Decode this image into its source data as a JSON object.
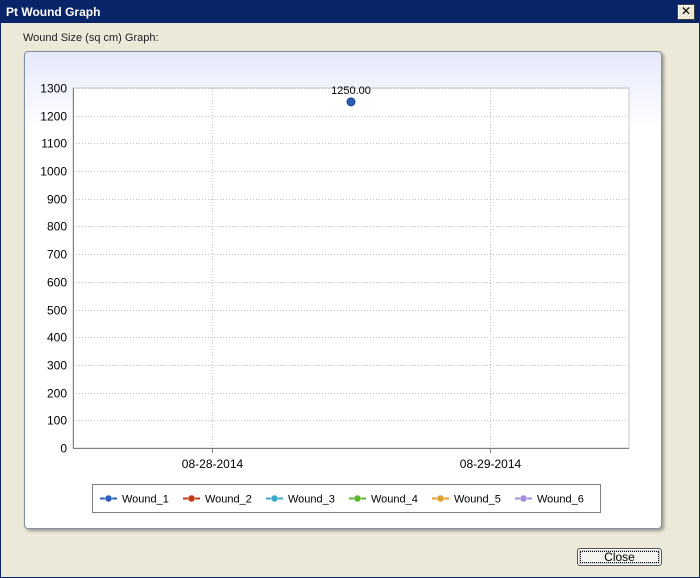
{
  "window": {
    "title": "Pt Wound Graph",
    "close_glyph": "✕"
  },
  "section_label": "Wound Size (sq cm) Graph:",
  "footer": {
    "close_label": "Close"
  },
  "colors": {
    "title_bar": "#0a246a",
    "wound_1": "#2e5fb8",
    "wound_2": "#c23b14",
    "wound_3": "#3fa9c6",
    "wound_4": "#5cb82e",
    "wound_5": "#e0a02c",
    "wound_6": "#a78ce0"
  },
  "chart_data": {
    "type": "line",
    "title": "",
    "xlabel": "",
    "ylabel": "",
    "x_categories": [
      "08-28-2014",
      "08-29-2014"
    ],
    "ylim": [
      0,
      1300
    ],
    "y_ticks": [
      0,
      100,
      200,
      300,
      400,
      500,
      600,
      700,
      800,
      900,
      1000,
      1100,
      1200,
      1300
    ],
    "grid": true,
    "legend_position": "bottom",
    "series": [
      {
        "name": "Wound_1",
        "color": "#2e5fb8",
        "points": [
          {
            "x": "between 08-28-2014 and 08-29-2014",
            "x_index": 0.5,
            "y": 1250,
            "label": "1250.00"
          }
        ]
      },
      {
        "name": "Wound_2",
        "color": "#c23b14",
        "points": []
      },
      {
        "name": "Wound_3",
        "color": "#3fa9c6",
        "points": []
      },
      {
        "name": "Wound_4",
        "color": "#5cb82e",
        "points": []
      },
      {
        "name": "Wound_5",
        "color": "#e0a02c",
        "points": []
      },
      {
        "name": "Wound_6",
        "color": "#a78ce0",
        "points": []
      }
    ]
  }
}
